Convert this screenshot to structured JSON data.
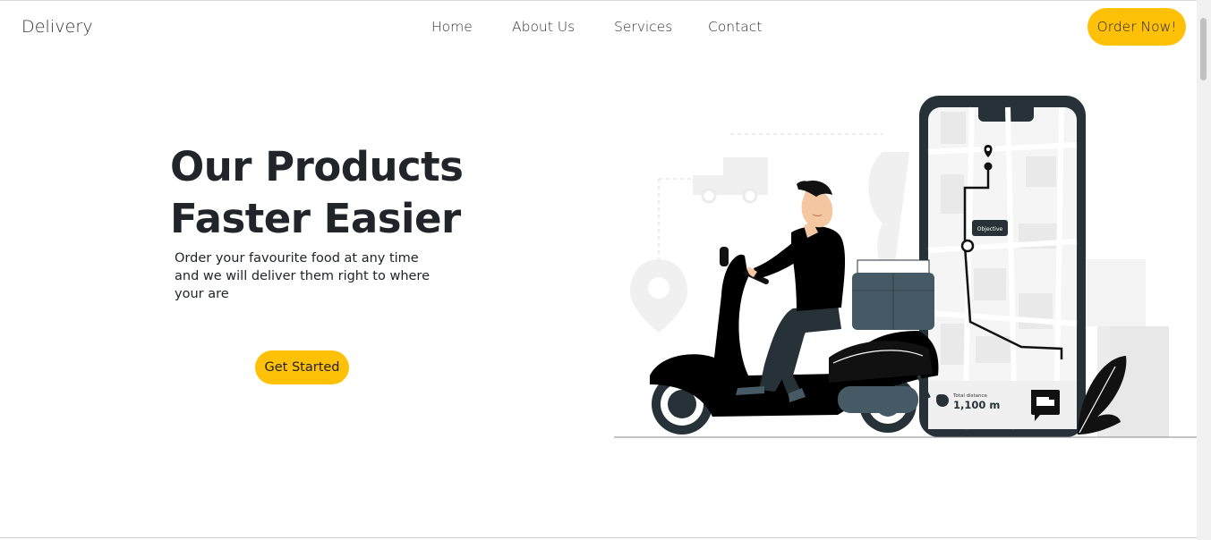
{
  "navbar": {
    "brand": "Delivery",
    "links": [
      "Home",
      "About Us",
      "Services",
      "Contact"
    ],
    "cta_label": "Order Now!"
  },
  "hero": {
    "title_line1": "Our Products",
    "title_line2": "Faster Easier",
    "description": "Order your favourite food at any time and we will deliver them right to where your are",
    "button_label": "Get Started"
  },
  "illustration": {
    "map_label": "Objective",
    "distance_caption": "Total distance",
    "distance_value": "1,100 m"
  },
  "colors": {
    "accent": "#ffc107",
    "dark": "#263238",
    "slate": "#455a64"
  }
}
